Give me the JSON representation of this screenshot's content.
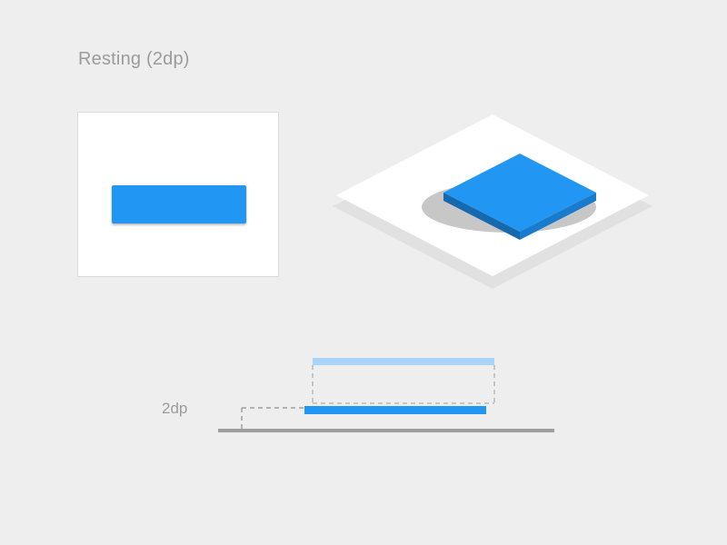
{
  "title": "Resting (2dp)",
  "elevation_label": "2dp",
  "colors": {
    "accent": "#2196F3",
    "accent_light": "#A8D4F7",
    "grey_line": "#9E9E9E",
    "card_border": "#DADADA",
    "bg": "#EEEEEE"
  }
}
